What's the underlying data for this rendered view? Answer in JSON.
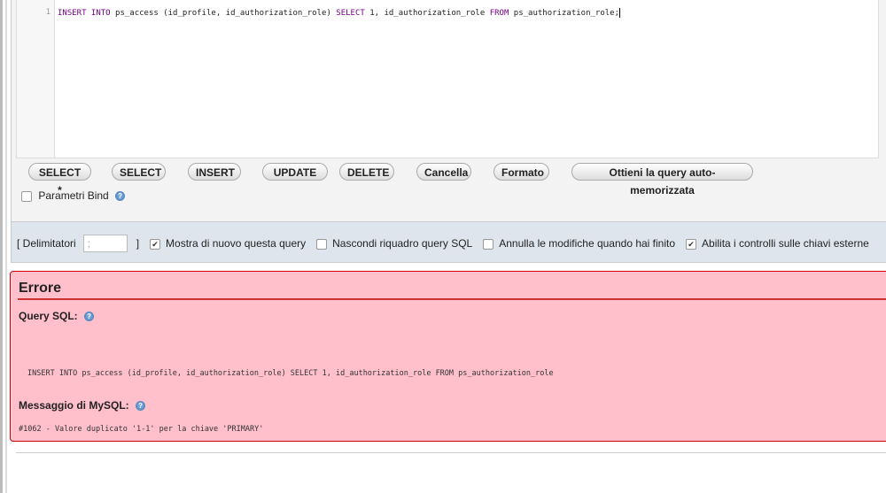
{
  "editor": {
    "line_number": "1",
    "sql_parts": [
      {
        "t": "INSERT INTO",
        "k": true
      },
      {
        "t": " ps_access (id_profile, id_authorization_role) ",
        "k": false
      },
      {
        "t": "SELECT",
        "k": true
      },
      {
        "t": " 1, id_authorization_role ",
        "k": false
      },
      {
        "t": "FROM",
        "k": true
      },
      {
        "t": " ps_authorization_role;",
        "k": false
      }
    ]
  },
  "buttons": [
    "SELECT *",
    "SELECT",
    "INSERT",
    "UPDATE",
    "DELETE",
    "Cancella",
    "Formato",
    "Ottieni la query auto-memorizzata"
  ],
  "bind_params": {
    "label": "Parametri Bind",
    "checked": false
  },
  "options": {
    "delim_label": "[ Delimitatori",
    "delim_value": ";",
    "delim_close": "]",
    "checks": [
      {
        "label": "Mostra di nuovo questa query",
        "checked": true
      },
      {
        "label": "Nascondi riquadro query SQL",
        "checked": false
      },
      {
        "label": "Annulla le modifiche quando hai finito",
        "checked": false
      },
      {
        "label": "Abilita i controlli sulle chiavi esterne",
        "checked": true
      }
    ]
  },
  "error": {
    "title": "Errore",
    "query_label": "Query SQL:",
    "query": "INSERT INTO ps_access (id_profile, id_authorization_role) SELECT 1, id_authorization_role FROM ps_authorization_role",
    "message_label": "Messaggio di MySQL:",
    "message": "#1062 - Valore duplicato '1-1' per la chiave 'PRIMARY'"
  }
}
